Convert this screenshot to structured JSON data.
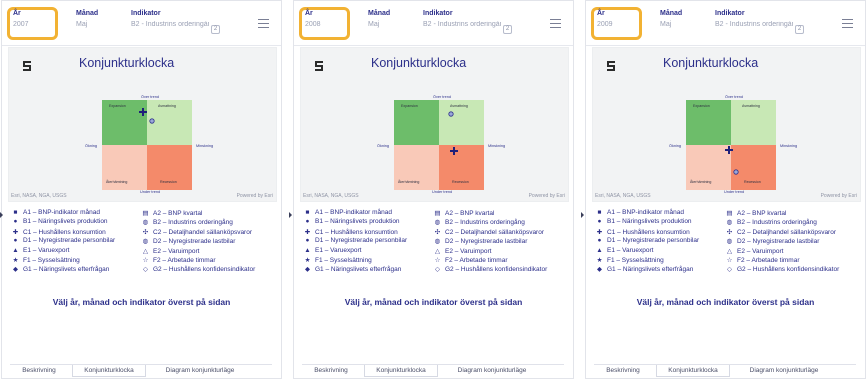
{
  "filters": {
    "year_label": "År",
    "month_label": "Månad",
    "indicator_label": "Indikator",
    "month_value": "Maj",
    "indicator_value": "B2 - Industrins orderingån...",
    "indicator_count": "2"
  },
  "chart": {
    "title": "Konjunkturklocka",
    "quadrants": {
      "expansion": "Expansion",
      "avmattning": "Avmattning",
      "aterhamtning": "Återhämtning",
      "recession": "Recession"
    },
    "axes": {
      "top": "Över trend",
      "bottom": "Under trend",
      "left": "Ökning",
      "right": "Minskning"
    },
    "attribution_left": "Esri, NASA, NGA, USGS",
    "attribution_right": "Powered by Esri"
  },
  "legend": [
    {
      "sym": "■",
      "label": "A1 – BNP-indikator månad"
    },
    {
      "sym": "▤",
      "label": "A2 – BNP kvartal"
    },
    {
      "sym": "●",
      "label": "B1 – Näringslivets produktion"
    },
    {
      "sym": "◍",
      "label": "B2 – Industrins orderingång"
    },
    {
      "sym": "✚",
      "label": "C1 – Hushållens konsumtion"
    },
    {
      "sym": "✣",
      "label": "C2 – Detaljhandel sällanköpsvaror"
    },
    {
      "sym": "●",
      "label": "D1 – Nyregistrerade personbilar"
    },
    {
      "sym": "◍",
      "label": "D2 – Nyregistrerade lastbilar"
    },
    {
      "sym": "▲",
      "label": "E1 – Varuexport"
    },
    {
      "sym": "△",
      "label": "E2 – Varuimport"
    },
    {
      "sym": "★",
      "label": "F1 – Sysselsättning"
    },
    {
      "sym": "☆",
      "label": "F2 – Arbetade timmar"
    },
    {
      "sym": "◆",
      "label": "G1 – Näringslivets efterfrågan"
    },
    {
      "sym": "◇",
      "label": "G2 – Hushållens konfidensindikator"
    }
  ],
  "prompt": "Välj år, månad och indikator överst på sidan",
  "tabs": [
    "Beskrivning",
    "Konjunkturklocka",
    "Diagram konjunkturläge"
  ],
  "active_tab": "Konjunkturklocka",
  "panels": [
    {
      "year": "2007",
      "markers": {
        "cross": [
          0.45,
          0.13
        ],
        "circle": [
          0.55,
          0.23
        ]
      }
    },
    {
      "year": "2008",
      "markers": {
        "circle": [
          0.63,
          0.16
        ],
        "cross": [
          0.67,
          0.57
        ]
      }
    },
    {
      "year": "2009",
      "markers": {
        "cross": [
          0.48,
          0.56
        ],
        "circle": [
          0.55,
          0.8
        ]
      }
    }
  ],
  "colors": {
    "expansion": "#6dbd6a",
    "avmattning": "#c8e8b5",
    "aterhamtning": "#f9c9b8",
    "recession": "#f48a6a",
    "highlight": "#f2b233",
    "text": "#2c2f8a"
  }
}
